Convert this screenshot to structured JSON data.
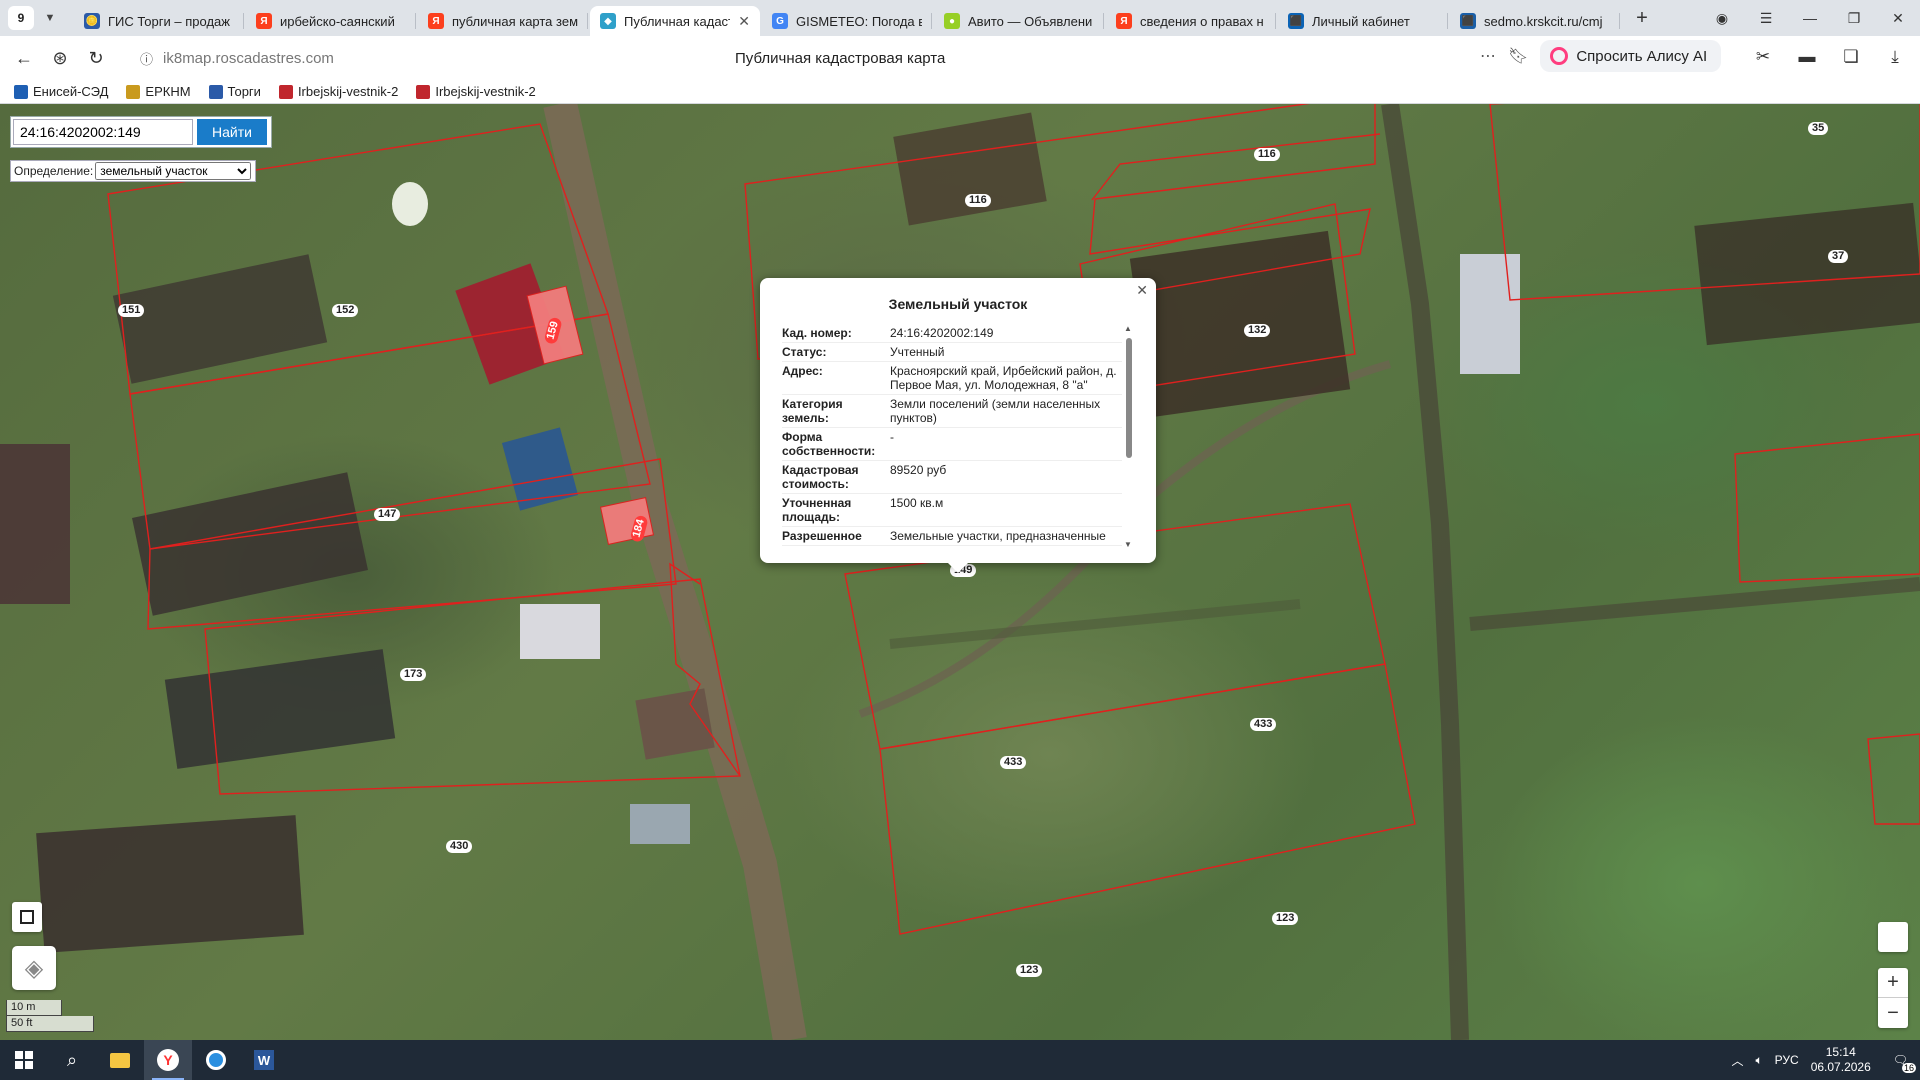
{
  "browser": {
    "tab_count": "9",
    "tabs": [
      {
        "label": "ГИС Торги – продаж",
        "fav_color": "#2b5aa8",
        "fav": "🪙"
      },
      {
        "label": "ирбейско-саянский",
        "fav_color": "#fc3f1d",
        "fav": "Я"
      },
      {
        "label": "публичная карта зем",
        "fav_color": "#fc3f1d",
        "fav": "Я"
      },
      {
        "label": "Публичная кадаст",
        "fav_color": "#2fa0c9",
        "fav": "◆",
        "active": true
      },
      {
        "label": "GISMETEO: Погода в",
        "fav_color": "#4285f4",
        "fav": "G"
      },
      {
        "label": "Авито — Объявлени",
        "fav_color": "#97cf26",
        "fav": "●"
      },
      {
        "label": "сведения о правах н",
        "fav_color": "#fc3f1d",
        "fav": "Я"
      },
      {
        "label": "Личный кабинет",
        "fav_color": "#0b63b5",
        "fav": "⬛"
      },
      {
        "label": "sedmo.krskcit.ru/cmj",
        "fav_color": "#1a5fa8",
        "fav": "⬛"
      }
    ],
    "url": "ik8map.roscadastres.com",
    "page_title": "Публичная кадастровая карта",
    "alice_label": "Спросить Алису AI",
    "bookmarks": [
      {
        "label": "Енисей-СЭД",
        "color": "#1e5fb3"
      },
      {
        "label": "ЕРКНМ",
        "color": "#c99a1e"
      },
      {
        "label": "Торги",
        "color": "#2b5aa8"
      },
      {
        "label": "Irbejskij-vestnik-2",
        "color": "#c0262d"
      },
      {
        "label": "Irbejskij-vestnik-2",
        "color": "#c0262d"
      }
    ]
  },
  "map": {
    "search_value": "24:16:4202002:149",
    "search_button": "Найти",
    "definition_label": "Определение:",
    "definition_value": "земельный участок",
    "scale_m": "10 m",
    "scale_ft": "50 ft",
    "zoom_in": "+",
    "zoom_out": "−",
    "parcels": [
      "35",
      "116",
      "116",
      "37",
      "152",
      "159",
      "132",
      "147",
      "184",
      "173",
      "433",
      "433",
      "430",
      "123",
      "123",
      "149",
      "151"
    ]
  },
  "popup": {
    "title": "Земельный участок",
    "rows": [
      {
        "k": "Кад. номер:",
        "v": "24:16:4202002:149"
      },
      {
        "k": "Статус:",
        "v": "Учтенный"
      },
      {
        "k": "Адрес:",
        "v": "Красноярский край, Ирбейский район, д. Первое Мая, ул. Молодежная, 8 \"а\""
      },
      {
        "k": "Категория земель:",
        "v": "Земли поселений (земли населенных пунктов)"
      },
      {
        "k": "Форма собственности:",
        "v": "-"
      },
      {
        "k": "Кадастровая стоимость:",
        "v": "89520 руб"
      },
      {
        "k": "Уточненная площадь:",
        "v": "1500 кв.м"
      },
      {
        "k": "Разрешенное",
        "v": "Земельные участки, предназначенные"
      }
    ]
  },
  "taskbar": {
    "lang": "РУС",
    "time": "15:14",
    "date": "06.07.2026",
    "notif": "16"
  }
}
